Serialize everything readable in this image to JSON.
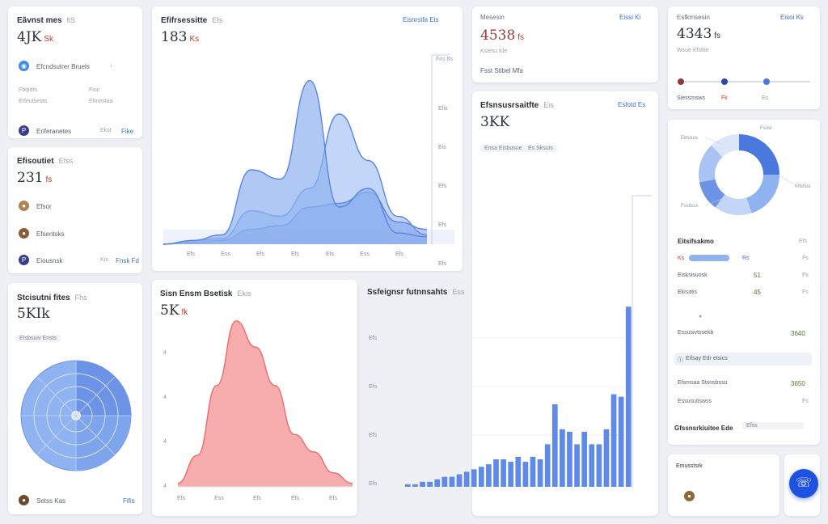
{
  "colors": {
    "accent": "#3b6fd8",
    "area_blue": "#8fb2f0",
    "area_blue_dark": "#6d93e6",
    "area_red": "#f48a8a",
    "fab": "#1f52e0",
    "value_red": "#c0392b"
  },
  "card_a": {
    "title": "Eãvnst mes",
    "sub": "fiS",
    "value": "4JK",
    "unit": "Sk",
    "item1": "Efcndsutrer Bruels",
    "label1": "Fbqidts",
    "label2": "Fiuc",
    "label3": "Erfeutsetas",
    "label4": "Ehnestaa",
    "item2": "Eriferanetes",
    "item2_val": "Ekst",
    "item2_badge": "Fike"
  },
  "card_b": {
    "title": "Efisoutiet",
    "sub": "Efss",
    "value": "231",
    "unit": "fs",
    "items": [
      {
        "label": "Efsor"
      },
      {
        "label": "Efsentsks"
      },
      {
        "label": "Eiousnsk",
        "val": "Kis",
        "badge": "Fnsk Fd"
      }
    ]
  },
  "card_c": {
    "title": "Stcisutni fites",
    "sub": "Fhs",
    "value": "5KIk",
    "chip": "EIsbsuiv Ensts",
    "footer": "Setss Kas",
    "footer_link": "Fifis"
  },
  "chart_main": {
    "title": "Efifrsessitte",
    "sub": "Efs",
    "value": "183",
    "unit": "Ks",
    "link": "Eisnrstfa Eis",
    "tag": "Fits Bs"
  },
  "card_d": {
    "label": "Mesesin",
    "link": "Eissi Ki",
    "value": "4538",
    "unit": "fs",
    "sub1": "Ksiesu Kfe",
    "sub2": "Fsst Stibel Mfa"
  },
  "card_e": {
    "title": "Efsnsusrsaitfte",
    "sub": "Eis",
    "value": "3KK",
    "link": "Esfotd Es",
    "chip1": "Ensa Eisbusue",
    "chip2": "Es Sksuis"
  },
  "card_f": {
    "label": "Esfkmsesin",
    "link": "Eisoi Ks",
    "value": "4343",
    "unit": "fs",
    "sub": "Wsue Kfsfde",
    "slider_label": "Siessmsws",
    "slider_a": "Fk",
    "slider_b": "Es"
  },
  "chart_red": {
    "title": "Sisn Ensm Bsetisk",
    "sub": "Ekis",
    "value": "5K",
    "unit": "fk"
  },
  "chart_bars": {
    "title": "Ssfeignsr futnnsahts",
    "sub": "Ess"
  },
  "card_g": {
    "donut_labels": [
      "Edsisus",
      "Kflsfssi",
      "Fssitsss",
      "Fsust"
    ],
    "rows": [
      {
        "label": "Eitsifsakmo",
        "value": "",
        "right": "Efs"
      },
      {
        "label": "Ks",
        "value": "Rs",
        "right": "Fs"
      },
      {
        "label": "Eisksisuosk",
        "value": "51",
        "right": "Fs"
      },
      {
        "label": "Ekisatis",
        "value": "45",
        "right": "Fs"
      },
      {
        "label": "Essusivtssekb",
        "value": "3640",
        "right": ""
      },
      {
        "label": "Efsmsaa Stsnsbssu",
        "value": "3650",
        "right": ""
      },
      {
        "label": "Essusutiswss",
        "value": "",
        "right": "Fs"
      }
    ],
    "highlight": "Eifsay Edr etsics",
    "footer_label": "Gfssnsrkiuitee Ede",
    "footer_chip": "Efss"
  },
  "card_h": {
    "label": "Emusstsrk"
  },
  "fab_icon": "support-icon",
  "chart_data": [
    {
      "type": "area",
      "title": "Efifrsessitte",
      "x": [
        "Efs",
        "Ess",
        "Efs",
        "Efs",
        "Efs",
        "Ess",
        "Efs"
      ],
      "series": [
        {
          "name": "",
          "values": [
            0,
            2,
            5,
            40,
            35,
            88,
            20,
            30,
            6,
            4
          ]
        },
        {
          "name": "",
          "values": [
            0,
            2,
            3,
            18,
            15,
            30,
            70,
            45,
            15,
            5
          ]
        },
        {
          "name": "",
          "values": [
            0,
            1,
            2,
            8,
            10,
            20,
            22,
            28,
            12,
            8
          ]
        }
      ],
      "ylabels": [
        "Efis",
        "Eis",
        "Efs",
        "Efs",
        "Efs"
      ]
    },
    {
      "type": "area",
      "title": "Sisn Ensm Bsetisk",
      "x": [
        "Efs",
        "Ess",
        "Efs",
        "Efs",
        "Efs"
      ],
      "values": [
        2,
        18,
        58,
        95,
        80,
        58,
        30,
        20,
        8,
        2
      ],
      "ylabels": [
        "4",
        "4",
        "4",
        "4"
      ]
    },
    {
      "type": "bar",
      "title": "Ssfeignsr futnnsahts",
      "values": [
        1,
        1,
        2,
        2,
        3,
        4,
        4,
        5,
        6,
        7,
        8,
        9,
        11,
        11,
        10,
        12,
        10,
        12,
        11,
        17,
        33,
        23,
        22,
        17,
        22,
        17,
        17,
        23,
        37,
        36,
        72
      ],
      "ylabels": [
        "Efs",
        "Efs",
        "Efs",
        "Efs"
      ]
    }
  ]
}
